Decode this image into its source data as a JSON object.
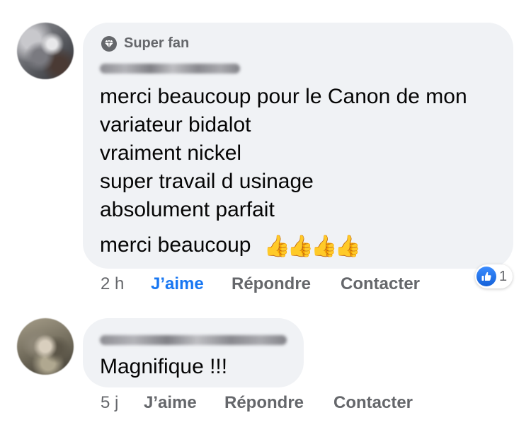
{
  "comments": [
    {
      "badge": {
        "icon": "diamond-icon",
        "label": "Super fan"
      },
      "lines": [
        "merci beaucoup pour le Canon de mon",
        "variateur bidalot",
        "vraiment nickel",
        "super travail d usinage",
        "absolument parfait",
        "merci beaucoup"
      ],
      "emoji": "👍👍👍👍",
      "time": "2 h",
      "like_label": "J’aime",
      "reply_label": "Répondre",
      "contact_label": "Contacter",
      "reaction": {
        "icon": "like-reaction-icon",
        "count": "1"
      }
    },
    {
      "lines": [
        "Magnifique  !!!"
      ],
      "time": "5 j",
      "like_label": "J’aime",
      "reply_label": "Répondre",
      "contact_label": "Contacter"
    }
  ],
  "colors": {
    "bubble": "#f0f2f5",
    "meta_text": "#65676b",
    "liked": "#1877f2",
    "text": "#050505"
  }
}
